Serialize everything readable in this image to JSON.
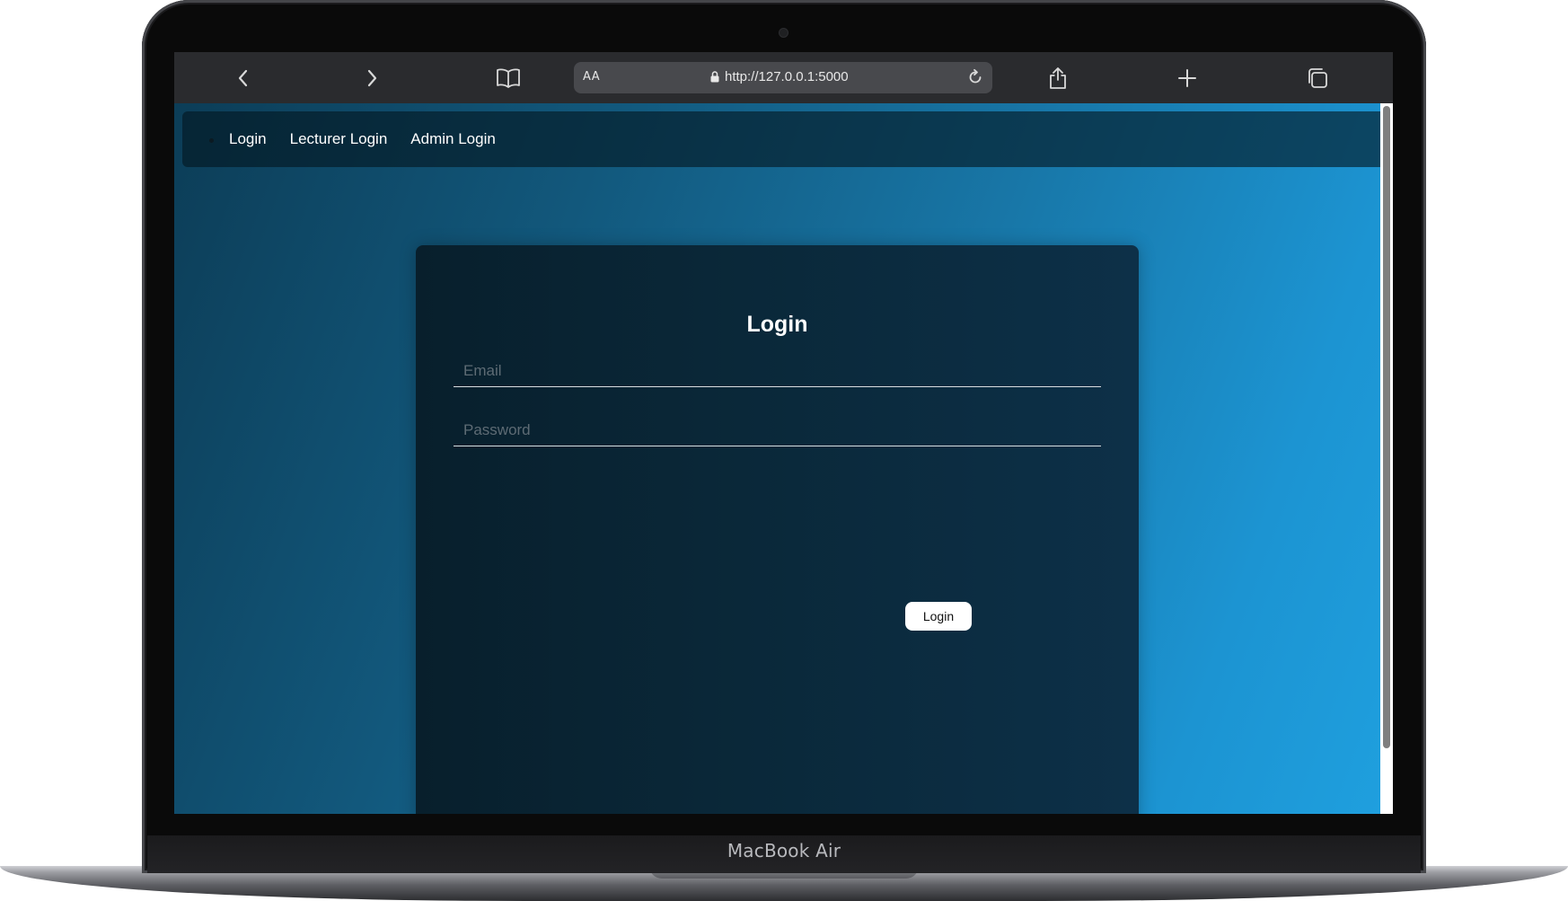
{
  "device": {
    "brand_label": "MacBook Air"
  },
  "browser": {
    "reader_label": "AA",
    "url": "http://127.0.0.1:5000",
    "icons": {
      "back": "chevron-left-icon",
      "forward": "chevron-right-icon",
      "bookmarks": "book-icon",
      "lock": "lock-icon",
      "reload": "reload-icon",
      "share": "share-icon",
      "new_tab": "plus-icon",
      "tabs": "tabs-icon"
    }
  },
  "nav": {
    "links": [
      {
        "label": "Login"
      },
      {
        "label": "Lecturer Login"
      },
      {
        "label": "Admin Login"
      }
    ]
  },
  "login_form": {
    "title": "Login",
    "email_placeholder": "Email",
    "email_value": "",
    "password_placeholder": "Password",
    "password_value": "",
    "submit_label": "Login"
  },
  "colors": {
    "page_gradient_start": "#0c3d57",
    "page_gradient_end": "#1f9fde",
    "card_background": "#0a2839",
    "button_background": "#ffffff"
  }
}
